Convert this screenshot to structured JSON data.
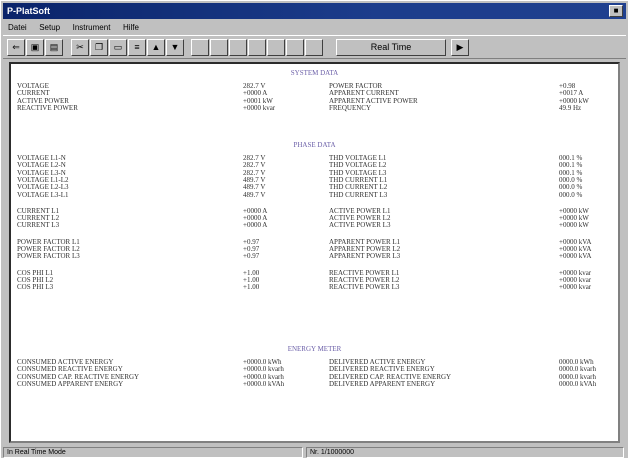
{
  "window": {
    "title": "P-PlatSoft",
    "close_glyph": "■"
  },
  "menu": [
    "Datei",
    "Setup",
    "Instrument",
    "Hilfe"
  ],
  "toolbar": {
    "realtime_label": "Real Time",
    "icons": [
      "open-icon",
      "save-icon",
      "print-icon",
      "cut-icon",
      "copy-icon",
      "paste-icon",
      "arrow-up-icon",
      "arrow-down-icon",
      "reset-icon",
      "play-icon"
    ]
  },
  "sections": [
    {
      "title": "SYSTEM DATA",
      "groups": [
        [
          [
            "VOLTAGE",
            "282.7 V",
            "POWER FACTOR",
            "+0.98"
          ],
          [
            "CURRENT",
            "+0000 A",
            "APPARENT CURRENT",
            "+0017 A"
          ],
          [
            "ACTIVE POWER",
            "+0001 kW",
            "APPARENT ACTIVE POWER",
            "+0000 kW"
          ],
          [
            "REACTIVE POWER",
            "+0000 kvar",
            "FREQUENCY",
            "49.9 Hz"
          ]
        ]
      ]
    },
    {
      "title": "PHASE DATA",
      "groups": [
        [
          [
            "VOLTAGE L1-N",
            "282.7 V",
            "THD VOLTAGE L1",
            "000.1 %"
          ],
          [
            "VOLTAGE L2-N",
            "282.7 V",
            "THD VOLTAGE L2",
            "000.1 %"
          ],
          [
            "VOLTAGE L3-N",
            "282.7 V",
            "THD VOLTAGE L3",
            "000.1 %"
          ],
          [
            "VOLTAGE L1-L2",
            "489.7 V",
            "THD CURRENT L1",
            "000.0 %"
          ],
          [
            "VOLTAGE L2-L3",
            "489.7 V",
            "THD CURRENT L2",
            "000.0 %"
          ],
          [
            "VOLTAGE L3-L1",
            "489.7 V",
            "THD CURRENT L3",
            "000.0 %"
          ]
        ],
        [
          [
            "CURRENT L1",
            "+0000 A",
            "ACTIVE POWER L1",
            "+0000 kW"
          ],
          [
            "CURRENT L2",
            "+0000 A",
            "ACTIVE POWER L2",
            "+0000 kW"
          ],
          [
            "CURRENT L3",
            "+0000 A",
            "ACTIVE POWER L3",
            "+0000 kW"
          ]
        ],
        [
          [
            "POWER FACTOR L1",
            "+0.97",
            "APPARENT POWER L1",
            "+0000 kVA"
          ],
          [
            "POWER FACTOR L2",
            "+0.97",
            "APPARENT POWER L2",
            "+0000 kVA"
          ],
          [
            "POWER FACTOR L3",
            "+0.97",
            "APPARENT POWER L3",
            "+0000 kVA"
          ]
        ],
        [
          [
            "COS PHI L1",
            "+1.00",
            "REACTIVE POWER L1",
            "+0000 kvar"
          ],
          [
            "COS PHI L2",
            "+1.00",
            "REACTIVE POWER L2",
            "+0000 kvar"
          ],
          [
            "COS PHI L3",
            "+1.00",
            "REACTIVE POWER L3",
            "+0000 kvar"
          ]
        ]
      ]
    },
    {
      "title": "ENERGY METER",
      "groups": [
        [
          [
            "CONSUMED ACTIVE ENERGY",
            "+0000.0 kWh",
            "DELIVERED ACTIVE ENERGY",
            "0000.0 kWh"
          ],
          [
            "CONSUMED REACTIVE ENERGY",
            "+0000.0 kvarh",
            "DELIVERED REACTIVE ENERGY",
            "0000.0 kvarh"
          ],
          [
            "CONSUMED CAP. REACTIVE ENERGY",
            "+0000.0 kvarh",
            "DELIVERED CAP. REACTIVE ENERGY",
            "0000.0 kvarh"
          ],
          [
            "CONSUMED APPARENT ENERGY",
            "+0000.0 kVAh",
            "DELIVERED APPARENT ENERGY",
            "0000.0 kVAh"
          ]
        ]
      ]
    }
  ],
  "status": {
    "left": "In Real Time Mode",
    "right": "Nr. 1/1000000"
  }
}
